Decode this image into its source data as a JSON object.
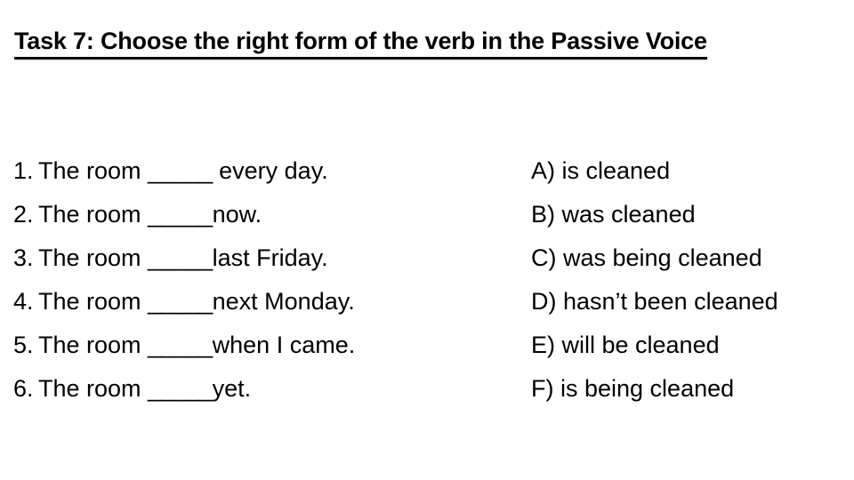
{
  "slide": {
    "background_color": "#ffffff",
    "text_color": "#000000"
  },
  "title": {
    "task_label": "Task 7:",
    "rest": " Choose the right form of the verb in the Passive Voice",
    "full": "Task 7: Choose the right form of the verb in the Passive Voice",
    "underlined": true,
    "bold": true
  },
  "questions": [
    {
      "number": "1.",
      "before_blank": "The room ",
      "blank": "_____",
      "after_blank": " every day.",
      "full": "1. The room _____ every day."
    },
    {
      "number": "2.",
      "before_blank": "The room ",
      "blank": "_____",
      "after_blank": "now.",
      "full": "2. The room _____now."
    },
    {
      "number": "3.",
      "before_blank": "The room ",
      "blank": "_____",
      "after_blank": "last Friday.",
      "full": "3. The room _____last Friday."
    },
    {
      "number": "4.",
      "before_blank": "The room ",
      "blank": "_____",
      "after_blank": "next Monday.",
      "full": "4. The room _____next Monday."
    },
    {
      "number": "5.",
      "before_blank": "The room ",
      "blank": "_____",
      "after_blank": "when I came.",
      "full": "5. The room _____when I came."
    },
    {
      "number": "6.",
      "before_blank": "The room ",
      "blank": "_____",
      "after_blank": "yet.",
      "full": "6. The room _____yet."
    }
  ],
  "answers": [
    {
      "letter": "A)",
      "text": " is cleaned",
      "full": "A) is cleaned"
    },
    {
      "letter": "B)",
      "text": " was cleaned",
      "full": "B) was cleaned"
    },
    {
      "letter": "C)",
      "text": " was being cleaned",
      "full": "C) was being cleaned"
    },
    {
      "letter": "D)",
      "text": " hasn’t been cleaned",
      "full": "D) hasn’t been cleaned"
    },
    {
      "letter": "E)",
      "text": " will be cleaned",
      "full": "E) will be cleaned"
    },
    {
      "letter": "F)",
      "text": " is being cleaned",
      "full": "F) is being cleaned"
    }
  ]
}
